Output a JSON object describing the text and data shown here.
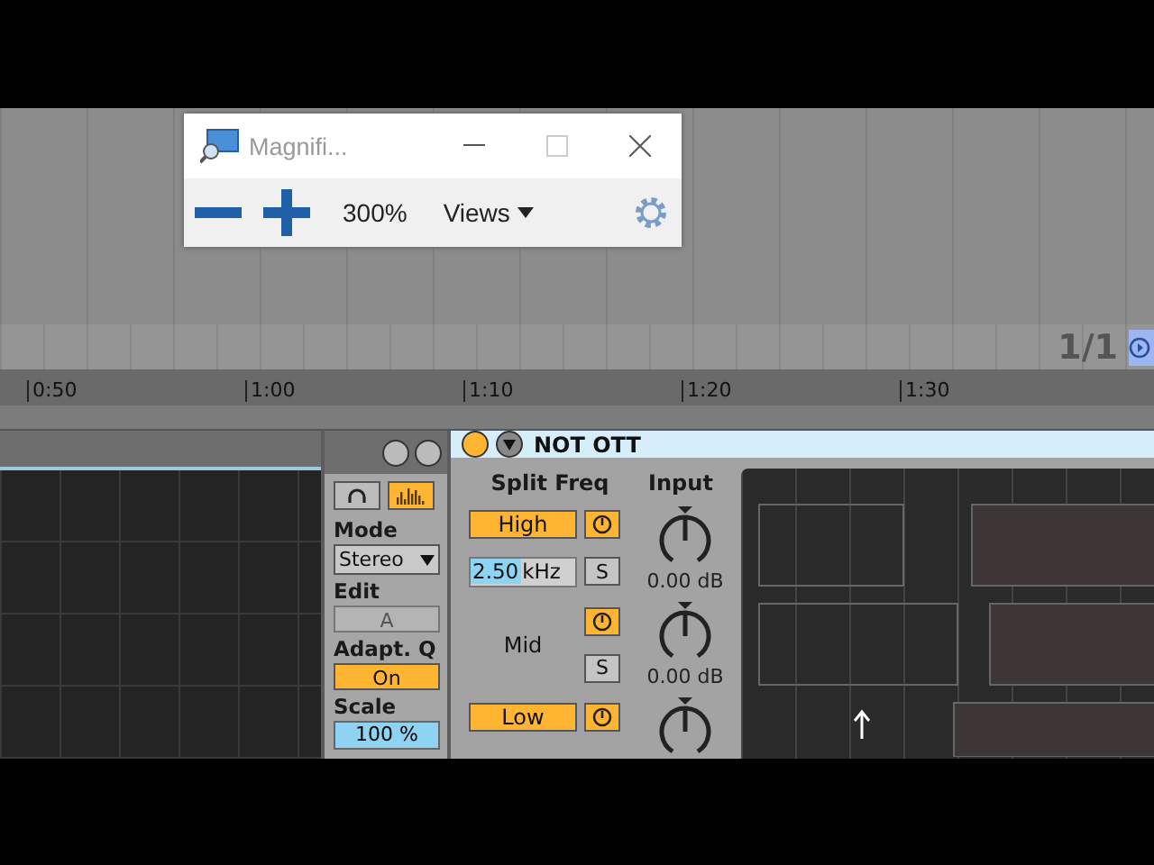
{
  "magnifier": {
    "title": "Magnifi...",
    "zoom": "300%",
    "views": "Views"
  },
  "arrangement": {
    "loop_counter": "1/1",
    "time_ticks": [
      "0:50",
      "1:00",
      "1:10",
      "1:20",
      "1:30"
    ]
  },
  "eq_panel": {
    "mode_label": "Mode",
    "mode": "Stereo",
    "edit_label": "Edit",
    "edit": "A",
    "edit_disabled": true,
    "adapt_q_label": "Adapt. Q",
    "adapt_q": "On",
    "adapt_q_on": true,
    "scale_label": "Scale",
    "scale": "100 %"
  },
  "device": {
    "title": "NOT OTT",
    "on": true,
    "split_freq_label": "Split Freq",
    "input_label": "Input",
    "bands": [
      {
        "name": "High",
        "active": true,
        "on": true,
        "freq_value": "2.50",
        "freq_unit": "kHz",
        "solo": "S",
        "gain": "0.00 dB"
      },
      {
        "name": "Mid",
        "active": false,
        "on": true,
        "solo": "S",
        "gain": "0.00 dB"
      },
      {
        "name": "Low",
        "active": true,
        "on": true
      }
    ]
  }
}
